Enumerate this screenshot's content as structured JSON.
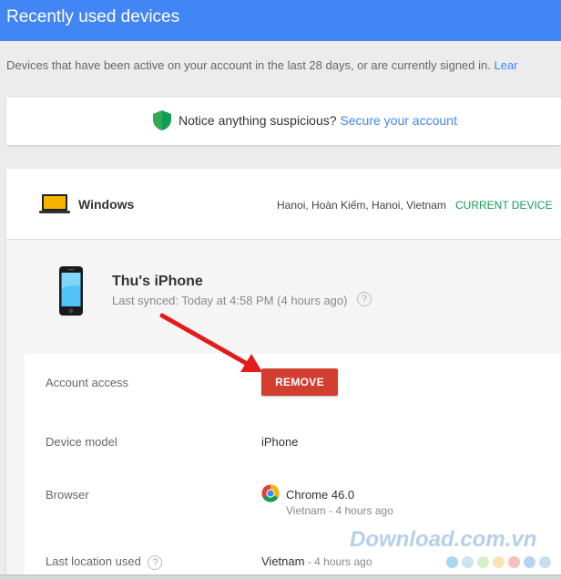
{
  "header": {
    "title": "Recently used devices"
  },
  "intro": {
    "text": "Devices that have been active on your account in the last 28 days, or are currently signed in.",
    "link": "Lear"
  },
  "notice": {
    "icon": "shield-check-icon",
    "text": "Notice anything suspicious?",
    "link": "Secure your account"
  },
  "windows_device": {
    "icon": "laptop-icon",
    "name": "Windows",
    "location": "Hanoi, Hoàn Kiếm, Hanoi, Vietnam",
    "status": "CURRENT DEVICE",
    "status_color": "#0f9d58"
  },
  "iphone_device": {
    "icon": "iphone-icon",
    "name": "Thu's iPhone",
    "last_synced": "Last synced: Today at 4:58 PM (4 hours ago)"
  },
  "details": {
    "account_access_label": "Account access",
    "remove_label": "REMOVE",
    "remove_color": "#d23f31",
    "device_model_label": "Device model",
    "device_model_value": "iPhone",
    "browser_label": "Browser",
    "browser_value": "Chrome 46.0",
    "browser_sub": "Vietnam - 4 hours ago",
    "last_location_label": "Last location used",
    "last_location_value": "Vietnam",
    "last_location_sub": " - 4 hours ago"
  },
  "help_glyph": "?",
  "watermark": {
    "text": "Download.com.vn",
    "dot_colors": [
      "#a7d8f0",
      "#cfe3ee",
      "#d7efc9",
      "#fde2b5",
      "#f6c0bd",
      "#b6d3f2",
      "#c7dcef"
    ]
  }
}
